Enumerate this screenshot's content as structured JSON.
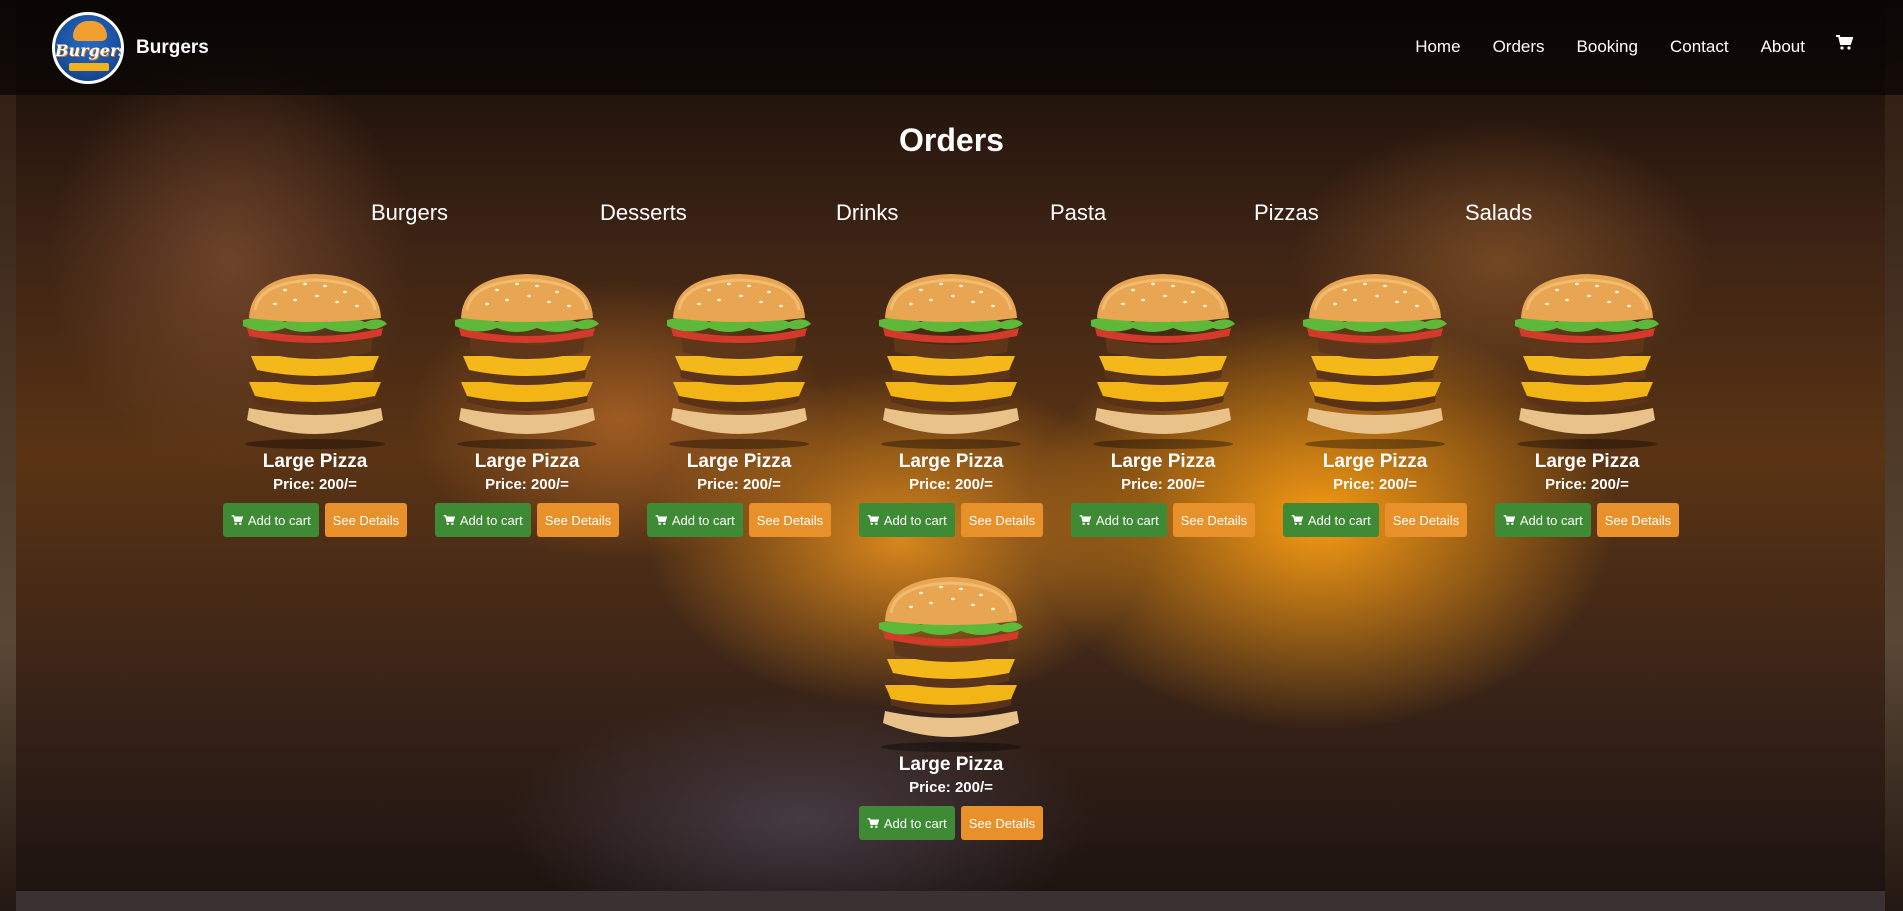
{
  "brand": {
    "name": "Burgers",
    "logo_text": "Burgers"
  },
  "nav": {
    "items": [
      "Home",
      "Orders",
      "Booking",
      "Contact",
      "About"
    ],
    "cart_icon": "cart-icon"
  },
  "page": {
    "title": "Orders"
  },
  "categories": [
    "Burgers",
    "Desserts",
    "Drinks",
    "Pasta",
    "Pizzas",
    "Salads"
  ],
  "products": [
    {
      "name": "Large Pizza",
      "price": "Price: 200/=",
      "add_label": "Add to cart",
      "details_label": "See Details"
    },
    {
      "name": "Large Pizza",
      "price": "Price: 200/=",
      "add_label": "Add to cart",
      "details_label": "See Details"
    },
    {
      "name": "Large Pizza",
      "price": "Price: 200/=",
      "add_label": "Add to cart",
      "details_label": "See Details"
    },
    {
      "name": "Large Pizza",
      "price": "Price: 200/=",
      "add_label": "Add to cart",
      "details_label": "See Details"
    },
    {
      "name": "Large Pizza",
      "price": "Price: 200/=",
      "add_label": "Add to cart",
      "details_label": "See Details"
    },
    {
      "name": "Large Pizza",
      "price": "Price: 200/=",
      "add_label": "Add to cart",
      "details_label": "See Details"
    },
    {
      "name": "Large Pizza",
      "price": "Price: 200/=",
      "add_label": "Add to cart",
      "details_label": "See Details"
    },
    {
      "name": "Large Pizza",
      "price": "Price: 200/=",
      "add_label": "Add to cart",
      "details_label": "See Details"
    }
  ],
  "colors": {
    "add_to_cart": "#3f8a34",
    "see_details": "#e8902a"
  }
}
